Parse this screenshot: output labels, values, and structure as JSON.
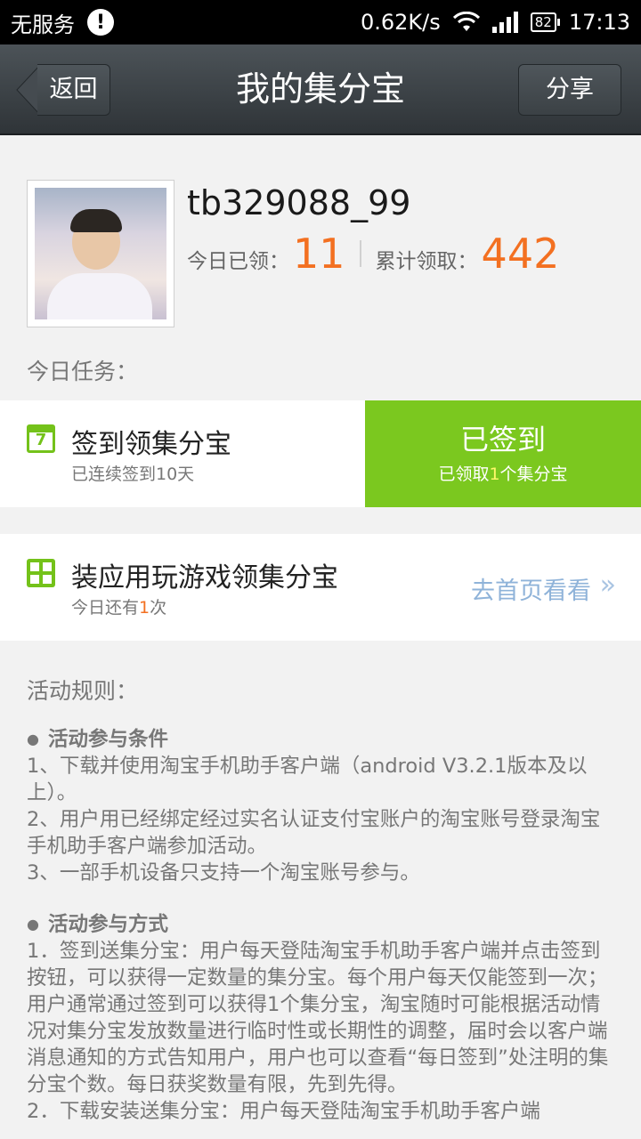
{
  "status_bar": {
    "carrier": "无服务",
    "alert_icon": "exclamation-icon",
    "speed": "0.62K/s",
    "battery": "82",
    "time": "17:13"
  },
  "nav": {
    "back_label": "返回",
    "title": "我的集分宝",
    "share_label": "分享"
  },
  "profile": {
    "username": "tb329088_99",
    "today_label": "今日已领：",
    "today_count": "11",
    "total_label": "累计领取：",
    "total_count": "442"
  },
  "tasks_label": "今日任务：",
  "task_signin": {
    "icon_number": "7",
    "title": "签到领集分宝",
    "subtitle": "已连续签到10天",
    "button_main": "已签到",
    "button_sub_prefix": "已领取",
    "button_sub_count": "1",
    "button_sub_suffix": "个集分宝"
  },
  "task_apps": {
    "title": "装应用玩游戏领集分宝",
    "subtitle_prefix": "今日还有",
    "subtitle_count": "1",
    "subtitle_suffix": "次",
    "link_label": "去首页看看",
    "link_chevron": "»"
  },
  "rules": {
    "title": "活动规则：",
    "section1_title": "活动参与条件",
    "section1_items": [
      "1、下载并使用淘宝手机助手客户端（android V3.2.1版本及以上）。",
      "2、用户用已经绑定经过实名认证支付宝账户的淘宝账号登录淘宝手机助手客户端参加活动。",
      "3、一部手机设备只支持一个淘宝账号参与。"
    ],
    "section2_title": "活动参与方式",
    "section2_items": [
      "1．签到送集分宝：用户每天登陆淘宝手机助手客户端并点击签到按钮，可以获得一定数量的集分宝。每个用户每天仅能签到一次；用户通常通过签到可以获得1个集分宝，淘宝随时可能根据活动情况对集分宝发放数量进行临时性或长期性的调整，届时会以客户端消息通知的方式告知用户，用户也可以查看“每日签到”处注明的集分宝个数。每日获奖数量有限，先到先得。",
      "2．下载安装送集分宝：用户每天登陆淘宝手机助手客户端"
    ]
  },
  "colors": {
    "accent_green": "#7bc81f",
    "accent_orange": "#f37021",
    "link_blue": "#8fb3d9",
    "nav_dark": "#3a4044"
  }
}
